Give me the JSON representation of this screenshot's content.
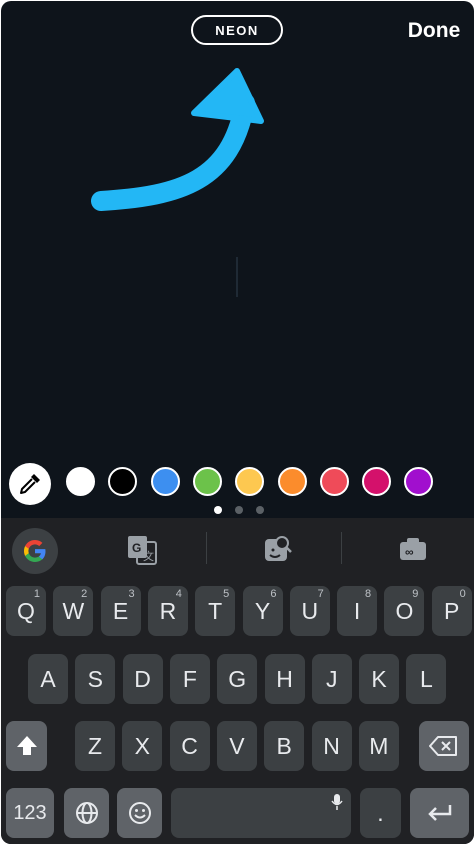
{
  "header": {
    "style_label": "NEON",
    "done_label": "Done"
  },
  "palette": {
    "colors": [
      "#ffffff",
      "#000000",
      "#3d8ff0",
      "#6cc24a",
      "#fdc850",
      "#fb8c2c",
      "#ef4b59",
      "#d4116b",
      "#a10fce"
    ],
    "page_count": 3,
    "current_page": 1
  },
  "keyboard": {
    "rows": [
      [
        {
          "label": "Q",
          "hint": "1"
        },
        {
          "label": "W",
          "hint": "2"
        },
        {
          "label": "E",
          "hint": "3"
        },
        {
          "label": "R",
          "hint": "4"
        },
        {
          "label": "T",
          "hint": "5"
        },
        {
          "label": "Y",
          "hint": "6"
        },
        {
          "label": "U",
          "hint": "7"
        },
        {
          "label": "I",
          "hint": "8"
        },
        {
          "label": "O",
          "hint": "9"
        },
        {
          "label": "P",
          "hint": "0"
        }
      ],
      [
        {
          "label": "A"
        },
        {
          "label": "S"
        },
        {
          "label": "D"
        },
        {
          "label": "F"
        },
        {
          "label": "G"
        },
        {
          "label": "H"
        },
        {
          "label": "J"
        },
        {
          "label": "K"
        },
        {
          "label": "L"
        }
      ],
      [
        {
          "label": "Z"
        },
        {
          "label": "X"
        },
        {
          "label": "C"
        },
        {
          "label": "V"
        },
        {
          "label": "B"
        },
        {
          "label": "N"
        },
        {
          "label": "M"
        }
      ]
    ],
    "numbers_label": "123",
    "period_label": "."
  },
  "colors": {
    "accent_arrow": "#23b7f5",
    "background": "#0e141b"
  }
}
